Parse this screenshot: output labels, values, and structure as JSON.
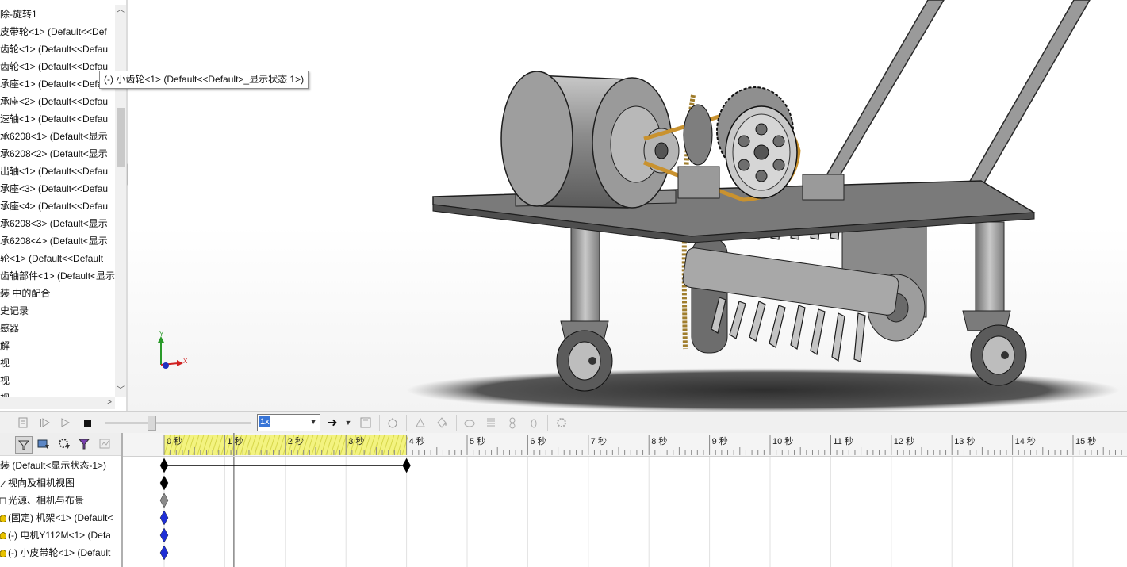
{
  "feature_tree": {
    "items": [
      "除-旋转1",
      "皮带轮<1> (Default<<Def",
      "齿轮<1> (Default<<Defau",
      "齿轮<1> (Default<<Defau",
      "承座<1> (Default<<Defa",
      "承座<2> (Default<<Defau",
      "速轴<1> (Default<<Defau",
      "承6208<1> (Default<显示",
      "承6208<2> (Default<显示",
      "出轴<1> (Default<<Defau",
      "承座<3> (Default<<Defau",
      "承座<4> (Default<<Defau",
      "承6208<3> (Default<显示",
      "承6208<4> (Default<显示",
      "轮<1> (Default<<Default",
      "齿轴部件<1> (Default<显示",
      "装 中的配合",
      "史记录",
      "感器",
      "解",
      "视",
      "视",
      "视"
    ]
  },
  "tooltip": {
    "text": "(-) 小齿轮<1> (Default<<Default>_显示状态 1>)"
  },
  "viewport": {
    "triad": {
      "y_label": "Y",
      "x_label": "X"
    }
  },
  "motion_toolbar": {
    "playback_speed": "1x",
    "icons": [
      "calculate-icon",
      "play-from-start-icon",
      "play-icon",
      "stop-icon",
      "speed-slider",
      "playback-speed-select",
      "playback-mode-icon",
      "save-animation-icon",
      "animation-wizard-icon",
      "autokey-icon",
      "add-key-icon",
      "motor-icon",
      "spring-icon",
      "contact-icon",
      "gravity-icon",
      "results-icon"
    ]
  },
  "motion_tree": {
    "filter_icons": [
      "filter-icon",
      "filter-animated-icon",
      "filter-driving-icon",
      "filter-selected-icon",
      "filter-results-icon"
    ],
    "rows": [
      {
        "label": "装  (Default<显示状态-1>)",
        "icon": "assembly-icon"
      },
      {
        "label": "视向及相机视图",
        "icon": "camera-icon"
      },
      {
        "label": "光源、相机与布景",
        "icon": "lights-folder-icon"
      },
      {
        "label": "(固定) 机架<1> (Default<",
        "icon": "part-icon"
      },
      {
        "label": "(-) 电机Y112M<1> (Defa",
        "icon": "part-icon"
      },
      {
        "label": "(-) 小皮带轮<1> (Default",
        "icon": "part-icon"
      }
    ]
  },
  "timeline": {
    "tick_labels": [
      "0 秒",
      "1 秒",
      "2 秒",
      "3 秒",
      "4 秒",
      "5 秒",
      "6 秒",
      "7 秒",
      "8 秒",
      "9 秒",
      "10 秒",
      "11 秒",
      "12 秒",
      "13 秒",
      "14 秒",
      "15 秒"
    ],
    "highlight_end_seconds": 4,
    "time_bar_seconds": 1.15,
    "colors": {
      "highlight": "#f3f380",
      "key_black": "#000000",
      "key_gray": "#8a8a8a",
      "key_blue": "#1f2fd6"
    },
    "keys": [
      {
        "row": 0,
        "time": 0,
        "color": "key_black"
      },
      {
        "row": 0,
        "time": 4,
        "color": "key_black"
      },
      {
        "row": 1,
        "time": 0,
        "color": "key_black"
      },
      {
        "row": 2,
        "time": 0,
        "color": "key_gray"
      },
      {
        "row": 3,
        "time": 0,
        "color": "key_blue"
      },
      {
        "row": 4,
        "time": 0,
        "color": "key_blue"
      },
      {
        "row": 5,
        "time": 0,
        "color": "key_blue"
      }
    ]
  }
}
